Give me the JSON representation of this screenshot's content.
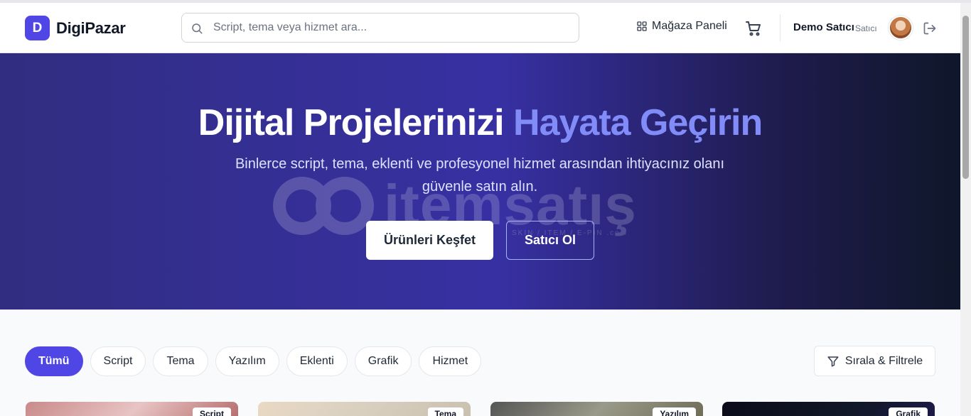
{
  "brand": {
    "logo_letter": "D",
    "name": "DigiPazar"
  },
  "search": {
    "placeholder": "Script, tema veya hizmet ara..."
  },
  "nav": {
    "store_panel": "Mağaza Paneli"
  },
  "user": {
    "name": "Demo Satıcı",
    "role": "Satıcı"
  },
  "hero": {
    "title_main": "Dijital Projelerinizi",
    "title_accent": "Hayata Geçirin",
    "subtitle": "Binlerce script, tema, eklenti ve profesyonel hizmet arasından ihtiyacınız olanı güvenle satın alın.",
    "primary_button": "Ürünleri Keşfet",
    "secondary_button": "Satıcı Ol",
    "watermark_text": "itemsatış",
    "watermark_sub": "SKIN / ITEM / E-PIN .com"
  },
  "categories": [
    {
      "label": "Tümü",
      "active": true
    },
    {
      "label": "Script",
      "active": false
    },
    {
      "label": "Tema",
      "active": false
    },
    {
      "label": "Yazılım",
      "active": false
    },
    {
      "label": "Eklenti",
      "active": false
    },
    {
      "label": "Grafik",
      "active": false
    },
    {
      "label": "Hizmet",
      "active": false
    }
  ],
  "filter_button": "Sırala & Filtrele",
  "product_cards": [
    {
      "badge": "Script"
    },
    {
      "badge": "Tema"
    },
    {
      "badge": "Yazılım"
    },
    {
      "badge": "Grafik"
    }
  ],
  "colors": {
    "brand": "#4f46e5",
    "accent": "#818cf8",
    "hero_start": "#312e81",
    "hero_end": "#0f172a"
  }
}
